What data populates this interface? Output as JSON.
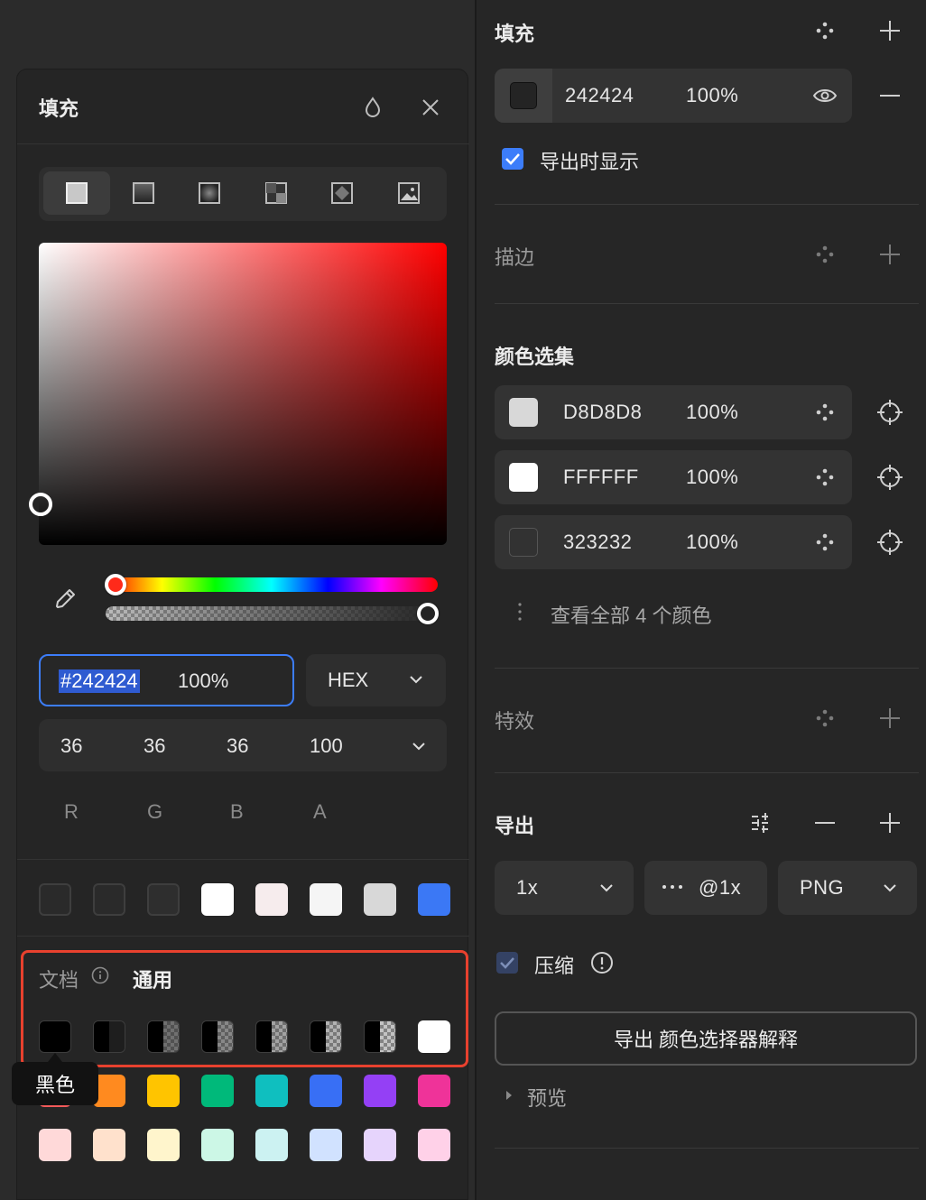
{
  "picker": {
    "title": "填充",
    "hex_value": "#242424",
    "opacity": "100%",
    "format": "HEX",
    "rgba_values": [
      "36",
      "36",
      "36",
      "100"
    ],
    "rgba_labels": [
      "R",
      "G",
      "B",
      "A"
    ],
    "hue_level": 0.0,
    "alpha_level": 1.0,
    "fill_types": [
      "solid-fill-icon",
      "linear-gradient-icon",
      "radial-gradient-icon",
      "angular-gradient-icon",
      "diamond-gradient-icon",
      "image-fill-icon"
    ],
    "recent_colors": [
      "#2a2a2a",
      "#2a2a2a",
      "#2e2e2e",
      "#ffffff",
      "#f6eced",
      "#f5f5f5",
      "#d8d8d8",
      "#3b78f5"
    ],
    "library_tabs": [
      "文档",
      "通用"
    ],
    "library_row1": [
      "#000000",
      "black-half-20",
      "black-half-40",
      "black-half-60",
      "black-half-80",
      "black-half-90",
      "black-half-95",
      "#ffffff"
    ],
    "tooltip": "黑色",
    "library_row2": [
      "#f25a5a",
      "#ff8a1f",
      "#ffc400",
      "#00b97a",
      "#0fbfbf",
      "#386ff5",
      "#9440f5",
      "#ef3399"
    ],
    "library_row3": [
      "#ffd9d9",
      "#ffe1cc",
      "#fff5cc",
      "#ccf7e6",
      "#ccf2f2",
      "#d1e2ff",
      "#e6d4fc",
      "#ffd1e8"
    ],
    "colors": {
      "highlight": "#e8412e",
      "accent": "#3c7dfa"
    }
  },
  "props": {
    "fill": {
      "title": "填充",
      "hex": "242424",
      "opacity": "100%",
      "swatch": "#242424"
    },
    "export_visible": "导出时显示",
    "stroke": {
      "title": "描边"
    },
    "selection_colors": {
      "title": "颜色选集",
      "items": [
        {
          "hex": "D8D8D8",
          "opacity": "100%",
          "swatch": "#d8d8d8"
        },
        {
          "hex": "FFFFFF",
          "opacity": "100%",
          "swatch": "#ffffff"
        },
        {
          "hex": "323232",
          "opacity": "100%",
          "swatch": "#323232"
        }
      ],
      "view_all": "查看全部 4 个颜色"
    },
    "effects": {
      "title": "特效"
    },
    "export": {
      "title": "导出",
      "scale": "1x",
      "suffix": "@1x",
      "format": "PNG",
      "compress": "压缩",
      "button": "导出 颜色选择器解释",
      "preview": "预览"
    }
  }
}
